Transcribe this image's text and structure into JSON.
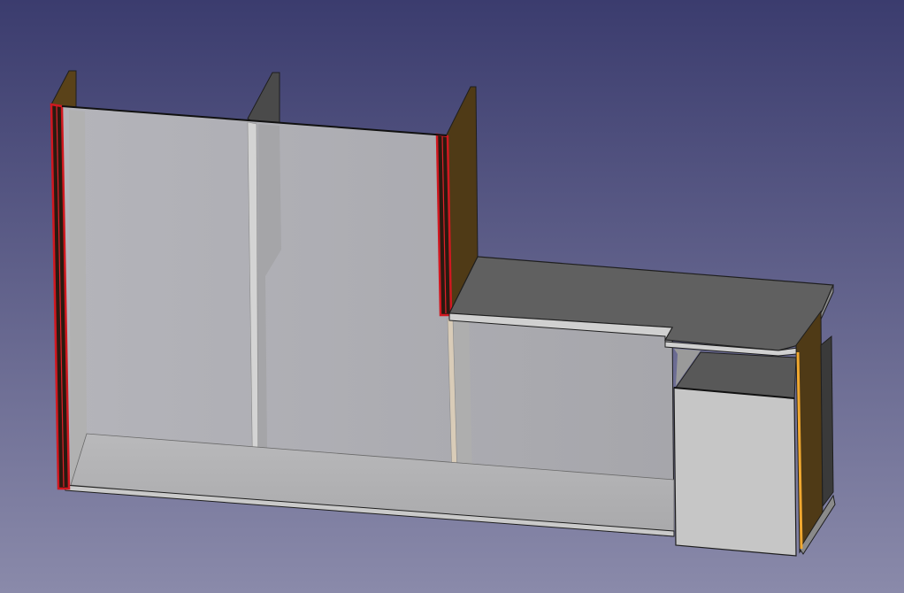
{
  "viewport": {
    "background_top": "#3b3c6e",
    "background_bottom": "#8a8aaa"
  },
  "colors": {
    "back_panel": "#a9a9ae",
    "back_panel_light": "#b6b6bb",
    "floor": "#b4b4b6",
    "floor_front": "#c9c9cb",
    "divider_dark": "#565656",
    "divider_edge": "#d6d6d6",
    "wood_dark": "#4f3a16",
    "wood_side": "#6b5020",
    "selection_red": "#c0141e",
    "highlight_orange": "#f0a830",
    "desk_top": "#5f5f5f",
    "desk_edge": "#cfcfcf",
    "drawer_front": "#c6c6c6",
    "drawer_top": "#5a5a5a",
    "edge_line": "#1e1e1e"
  }
}
